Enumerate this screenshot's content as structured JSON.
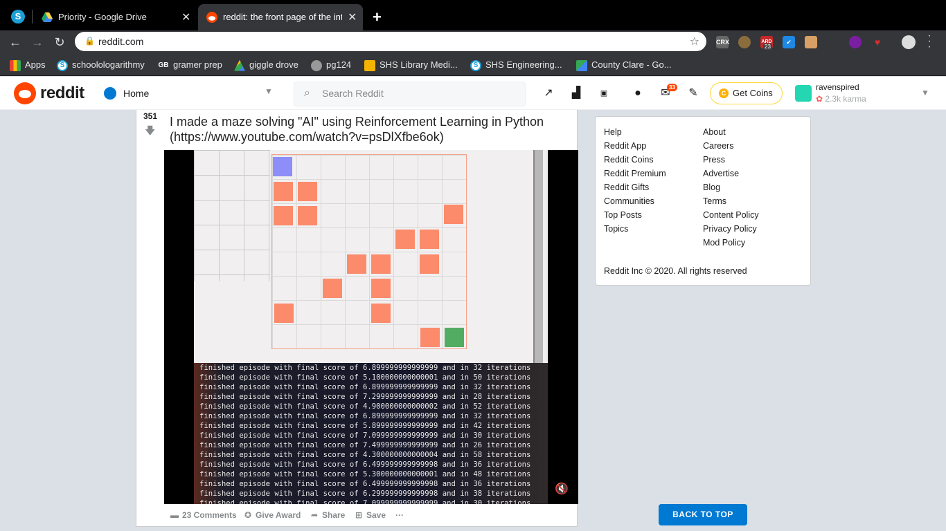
{
  "browser": {
    "profile_letter": "S",
    "tabs": [
      {
        "title": "Priority - Google Drive",
        "active": false
      },
      {
        "title": "reddit: the front page of the internet",
        "active": true
      }
    ],
    "url": "reddit.com",
    "extensions": [
      {
        "name": "crx-icon",
        "label": "CRX",
        "color": "#666666"
      },
      {
        "name": "owl-icon",
        "label": "",
        "color": "#8a6d3b"
      },
      {
        "name": "ard-icon",
        "label": "ARD",
        "color": "#c62828",
        "badge": "23"
      },
      {
        "name": "check-icon",
        "label": "✔",
        "color": "#1e88e5"
      },
      {
        "name": "box-icon",
        "label": "",
        "color": "#d9a066"
      },
      {
        "name": "dark-icon",
        "label": "",
        "color": "#222222"
      },
      {
        "name": "color-icon",
        "label": "",
        "color": "#7b1fa2"
      },
      {
        "name": "heart-icon",
        "label": "",
        "color": "#d32f2f"
      }
    ],
    "bookmarks": [
      {
        "name": "apps",
        "label": "Apps",
        "icon_color": "#4285f4",
        "icon_text": ""
      },
      {
        "name": "schoolologarithmy",
        "label": "schoolologarithmy",
        "icon_color": "#1b9fd6",
        "icon_text": "S"
      },
      {
        "name": "gramer-prep",
        "label": "gramer prep",
        "icon_color": "#333333",
        "icon_text": "GB"
      },
      {
        "name": "giggle-drove",
        "label": "giggle drove",
        "icon_color": "#fbbc04",
        "icon_text": ""
      },
      {
        "name": "pg124",
        "label": "pg124",
        "icon_color": "#999999",
        "icon_text": ""
      },
      {
        "name": "shs-library",
        "label": "SHS Library Medi...",
        "icon_color": "#f4b400",
        "icon_text": ""
      },
      {
        "name": "shs-engineering",
        "label": "SHS Engineering...",
        "icon_color": "#1b9fd6",
        "icon_text": "S"
      },
      {
        "name": "county-clare",
        "label": "County Clare - Go...",
        "icon_color": "#34a853",
        "icon_text": ""
      }
    ]
  },
  "header": {
    "wordmark": "reddit",
    "home_label": "Home",
    "search_placeholder": "Search Reddit",
    "mail_badge": "33",
    "get_coins": "Get Coins",
    "coin_symbol": "C",
    "username": "ravenspired",
    "karma": "2.3k karma"
  },
  "post": {
    "score": "351",
    "title": "I made a maze solving \"AI\" using Reinforcement Learning in Python (https://www.youtube.com/watch?v=psDlXfbe6ok)",
    "terminal_lines": [
      "finished episode with final score of 6.899999999999999 and in 32 iterations",
      "finished episode with final score of 5.100000000000001 and in 50 iterations",
      "finished episode with final score of 6.899999999999999 and in 32 iterations",
      "finished episode with final score of 7.299999999999999 and in 28 iterations",
      "finished episode with final score of 4.900000000000002 and in 52 iterations",
      "finished episode with final score of 6.899999999999999 and in 32 iterations",
      "finished episode with final score of 5.899999999999999 and in 42 iterations",
      "finished episode with final score of 7.099999999999999 and in 30 iterations",
      "finished episode with final score of 7.499999999999999 and in 26 iterations",
      "finished episode with final score of 4.300000000000004 and in 58 iterations",
      "finished episode with final score of 6.499999999999998 and in 36 iterations",
      "finished episode with final score of 5.300000000000001 and in 48 iterations",
      "finished episode with final score of 6.499999999999998 and in 36 iterations",
      "finished episode with final score of 6.299999999999998 and in 38 iterations",
      "finished episode with final score of 7.099999999999999 and in 30 iterations"
    ],
    "actions": {
      "comments": "23 Comments",
      "give_award": "Give Award",
      "share": "Share",
      "save": "Save",
      "more": "···"
    }
  },
  "sidebar": {
    "left_links": [
      "Help",
      "Reddit App",
      "Reddit Coins",
      "Reddit Premium",
      "Reddit Gifts",
      "Communities",
      "Top Posts",
      "Topics"
    ],
    "right_links": [
      "About",
      "Careers",
      "Press",
      "Advertise",
      "Blog",
      "Terms",
      "Content Policy",
      "Privacy Policy",
      "Mod Policy"
    ],
    "copyright": "Reddit Inc © 2020. All rights reserved"
  },
  "back_to_top": "BACK TO TOP"
}
